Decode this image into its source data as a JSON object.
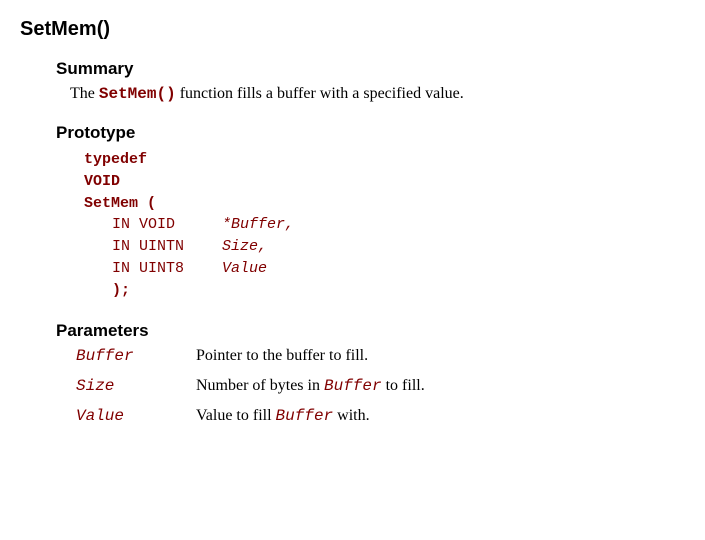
{
  "title": "SetMem()",
  "summary": {
    "heading": "Summary",
    "pre": "The ",
    "code": "SetMem()",
    "post": " function fills a buffer with a specified value."
  },
  "prototype": {
    "heading": "Prototype",
    "line1": "typedef",
    "line2": "VOID",
    "line3": "SetMem (",
    "args": [
      {
        "type": "IN VOID",
        "name": "*Buffer,",
        "padded_type": "IN VOID"
      },
      {
        "type": "IN UINTN",
        "name": "Size,",
        "padded_type": "IN UINTN"
      },
      {
        "type": "IN UINT8",
        "name": "Value",
        "padded_type": "IN UINT8"
      }
    ],
    "close": ");"
  },
  "parameters": {
    "heading": "Parameters",
    "items": [
      {
        "name": "Buffer",
        "desc_pre": "Pointer to the buffer to fill.",
        "code": "",
        "desc_post": ""
      },
      {
        "name": "Size",
        "desc_pre": "Number of bytes in ",
        "code": "Buffer",
        "desc_post": " to fill."
      },
      {
        "name": "Value",
        "desc_pre": "Value to fill ",
        "code": "Buffer",
        "desc_post": " with."
      }
    ]
  }
}
